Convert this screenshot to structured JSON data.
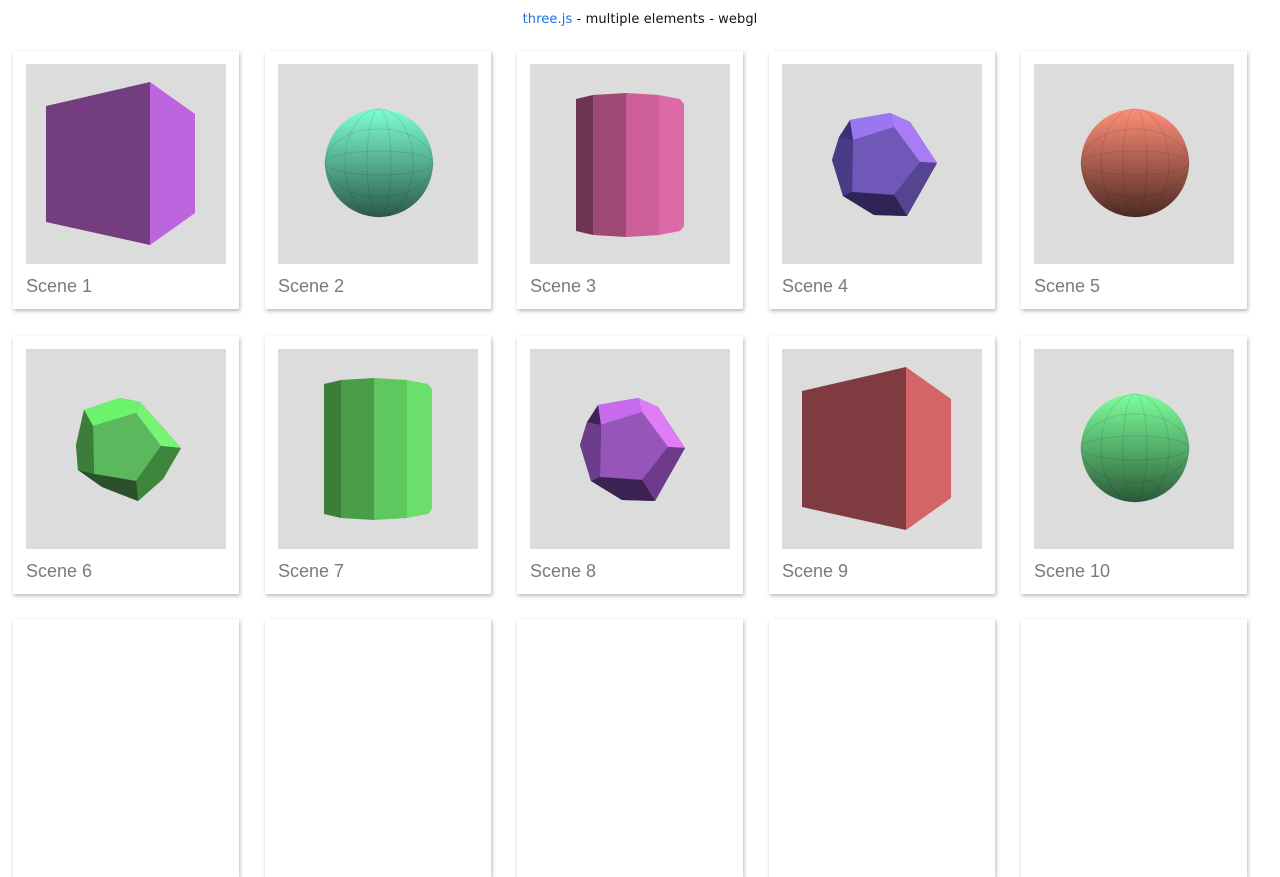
{
  "header": {
    "link_text": "three.js",
    "rest_text": " - multiple elements - webgl"
  },
  "scenes": [
    {
      "label": "Scene 1",
      "shape": "cube",
      "color": "#8f47a6"
    },
    {
      "label": "Scene 2",
      "shape": "sphere",
      "color": "#56d8b1"
    },
    {
      "label": "Scene 3",
      "shape": "cylinder",
      "color": "#d864a8"
    },
    {
      "label": "Scene 4",
      "shape": "dodecahedron",
      "color": "#8067d4"
    },
    {
      "label": "Scene 5",
      "shape": "sphere",
      "color": "#e9806c"
    },
    {
      "label": "Scene 6",
      "shape": "dodecahedron",
      "color": "#5fd15f"
    },
    {
      "label": "Scene 7",
      "shape": "cylinder",
      "color": "#5fd15f"
    },
    {
      "label": "Scene 8",
      "shape": "dodecahedron",
      "color": "#a85ed0"
    },
    {
      "label": "Scene 9",
      "shape": "cube",
      "color": "#c85656"
    },
    {
      "label": "Scene 10",
      "shape": "sphere",
      "color": "#5fd67e"
    }
  ]
}
